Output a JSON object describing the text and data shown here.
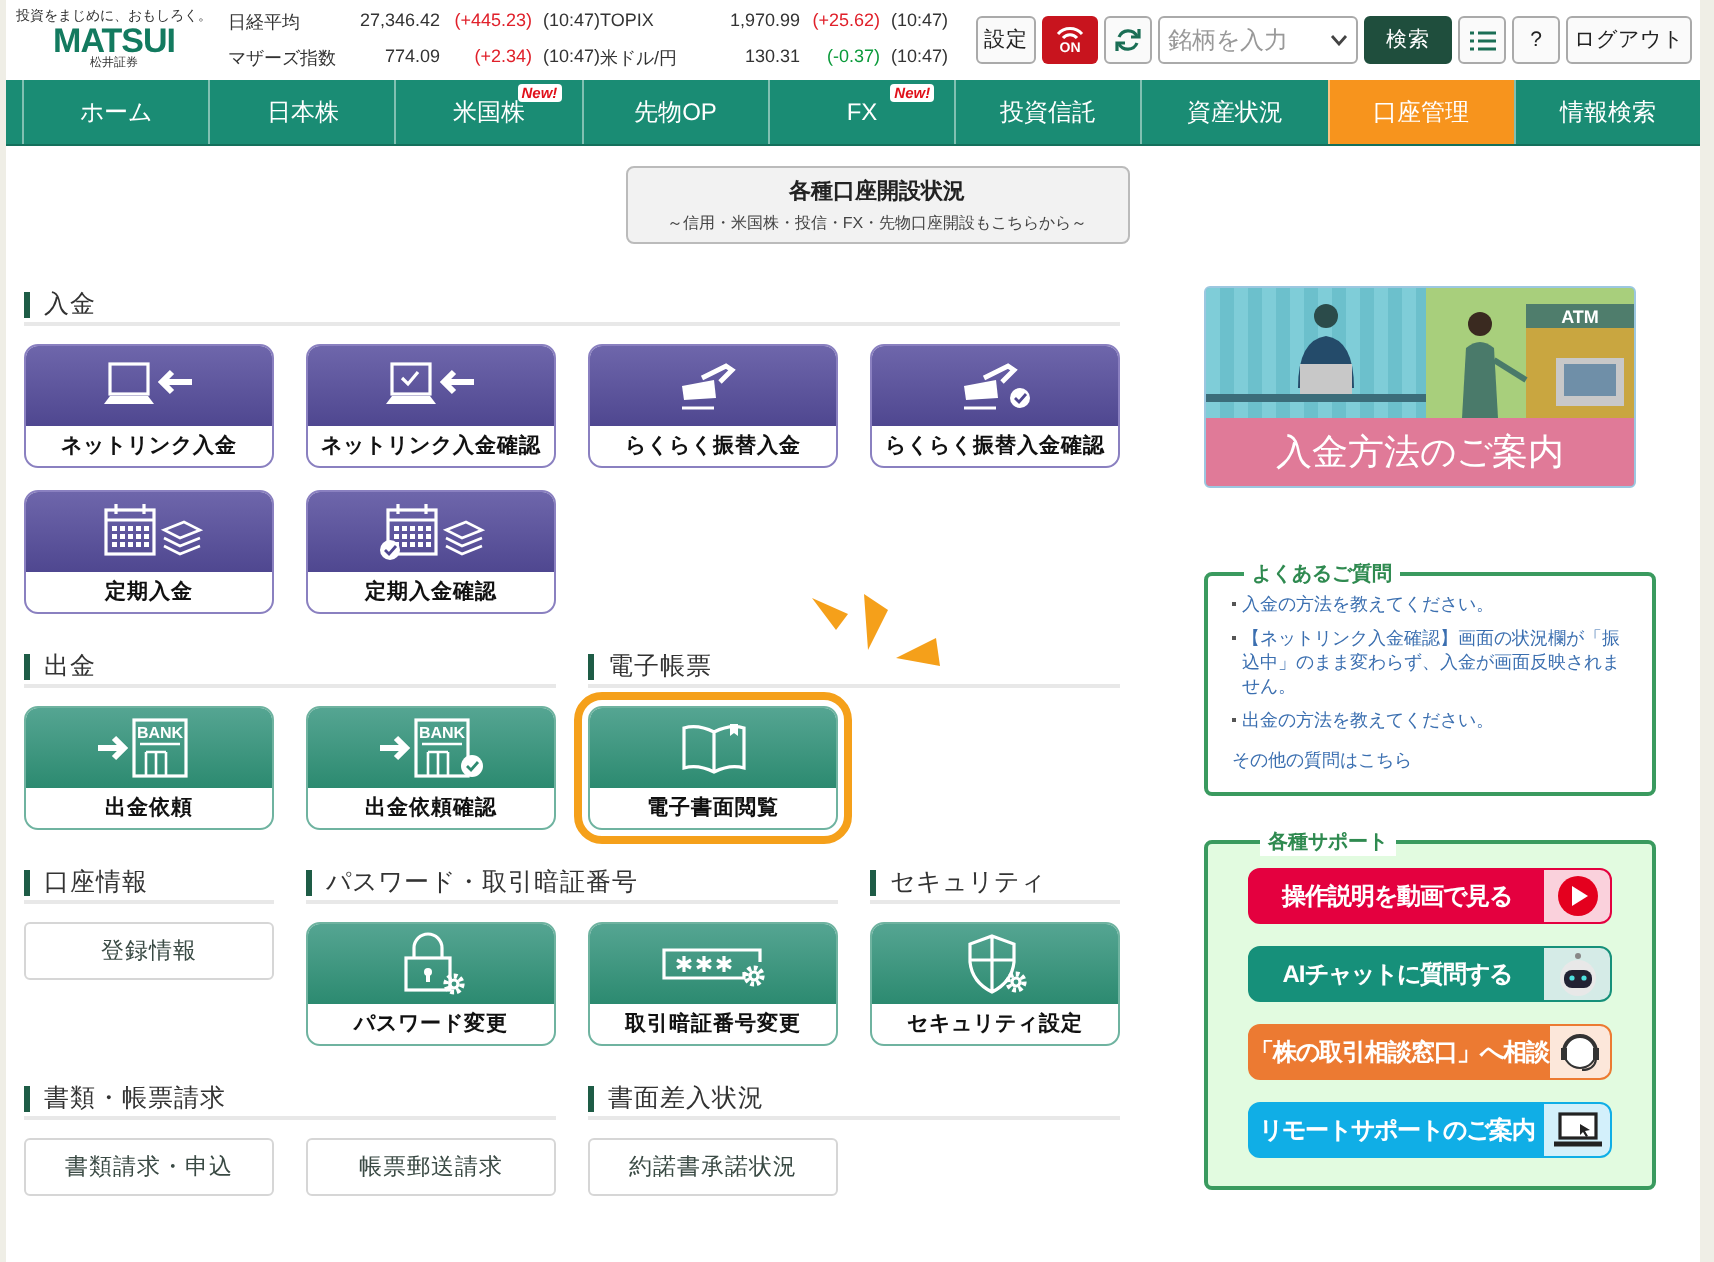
{
  "logo": {
    "tagline": "投資をまじめに、おもしろく。",
    "name": "MATSUI",
    "company": "松井証券"
  },
  "market": [
    {
      "label": "日経平均",
      "value": "27,346.42",
      "change": "(+445.23)",
      "color": "#e0202a",
      "time": "(10:47)"
    },
    {
      "label": "TOPIX",
      "value": "1,970.99",
      "change": "(+25.62)",
      "color": "#e0202a",
      "time": "(10:47)"
    },
    {
      "label": "マザーズ指数",
      "value": "774.09",
      "change": "(+2.34)",
      "color": "#e0202a",
      "time": "(10:47)"
    },
    {
      "label": "米ドル/円",
      "value": "130.31",
      "change": "(-0.37)",
      "color": "#0a9a3a",
      "time": "(10:47)"
    }
  ],
  "header_actions": {
    "settings": "設定",
    "toggle": {
      "label": "ON",
      "on": true
    },
    "search": {
      "placeholder": "銘柄を入力"
    },
    "search_button": "検索",
    "help": "?",
    "logout": "ログアウト"
  },
  "nav": [
    {
      "label": "ホーム",
      "selected": false
    },
    {
      "label": "日本株",
      "selected": false
    },
    {
      "label": "米国株",
      "selected": false,
      "badge": "New!"
    },
    {
      "label": "先物OP",
      "selected": false
    },
    {
      "label": "FX",
      "selected": false,
      "badge": "New!"
    },
    {
      "label": "投資信託",
      "selected": false
    },
    {
      "label": "資産状況",
      "selected": false
    },
    {
      "label": "口座管理",
      "selected": true
    },
    {
      "label": "情報検索",
      "selected": false
    }
  ],
  "account_status": {
    "title": "各種口座開設状況",
    "subtitle": "～信用・米国株・投信・FX・先物口座開設もこちらから～"
  },
  "rows": [
    {
      "sections": [
        {
          "title": "入金",
          "kind": "deposit",
          "items": [
            {
              "kind": "tile",
              "label": "ネットリンク入金",
              "highlighted": false
            },
            {
              "kind": "tile",
              "label": "ネットリンク入金確認",
              "highlighted": false
            },
            {
              "kind": "tile",
              "label": "らくらく振替入金",
              "highlighted": false
            },
            {
              "kind": "tile",
              "label": "らくらく振替入金確認",
              "highlighted": false
            },
            {
              "kind": "tile",
              "label": "定期入金",
              "highlighted": false
            },
            {
              "kind": "tile",
              "label": "定期入金確認",
              "highlighted": false
            }
          ]
        }
      ]
    },
    {
      "sections": [
        {
          "title": "出金",
          "kind": "standard",
          "items": [
            {
              "kind": "tile",
              "label": "出金依頼",
              "icon_text": "BANK",
              "highlighted": false
            },
            {
              "kind": "tile",
              "label": "出金依頼確認",
              "icon_text": "BANK",
              "highlighted": false
            }
          ]
        },
        {
          "title": "電子帳票",
          "kind": "standard",
          "items": [
            {
              "kind": "tile",
              "label": "電子書面閲覧",
              "highlighted": true
            }
          ]
        }
      ]
    },
    {
      "sections": [
        {
          "title": "口座情報",
          "kind": "standard",
          "items": [
            {
              "kind": "link",
              "label": "登録情報"
            }
          ]
        },
        {
          "title": "パスワード・取引暗証番号",
          "kind": "standard",
          "items": [
            {
              "kind": "tile",
              "label": "パスワード変更",
              "highlighted": false
            },
            {
              "kind": "tile",
              "label": "取引暗証番号変更",
              "highlighted": false
            }
          ]
        },
        {
          "title": "セキュリティ",
          "kind": "standard",
          "items": [
            {
              "kind": "tile",
              "label": "セキュリティ設定",
              "highlighted": false
            }
          ]
        }
      ]
    },
    {
      "sections": [
        {
          "title": "書類・帳票請求",
          "kind": "standard",
          "items": [
            {
              "kind": "link",
              "label": "書類請求・申込"
            },
            {
              "kind": "link",
              "label": "帳票郵送請求"
            }
          ]
        },
        {
          "title": "書面差入状況",
          "kind": "standard",
          "items": [
            {
              "kind": "link",
              "label": "約諾書承諾状況"
            }
          ]
        }
      ]
    }
  ],
  "banner": {
    "title": "入金方法のご案内",
    "sign": "ATM"
  },
  "faq": {
    "title": "よくあるご質問",
    "items": [
      "入金の方法を教えてください。",
      "【ネットリンク入金確認】画面の状況欄が「振込中」のまま変わらず、入金が画面反映されません。",
      "出金の方法を教えてください。"
    ],
    "more": "その他の質問はこちら"
  },
  "support": {
    "title": "各種サポート",
    "buttons": [
      {
        "label": "操作説明を動画で見る",
        "color": "#e4003f"
      },
      {
        "label": "AIチャットに質問する",
        "color": "#16907a"
      },
      {
        "label": "「株の取引相談窓口」へ相談",
        "color": "#ec7a32"
      },
      {
        "label": "リモートサポートのご案内",
        "color": "#10aee6"
      }
    ]
  }
}
